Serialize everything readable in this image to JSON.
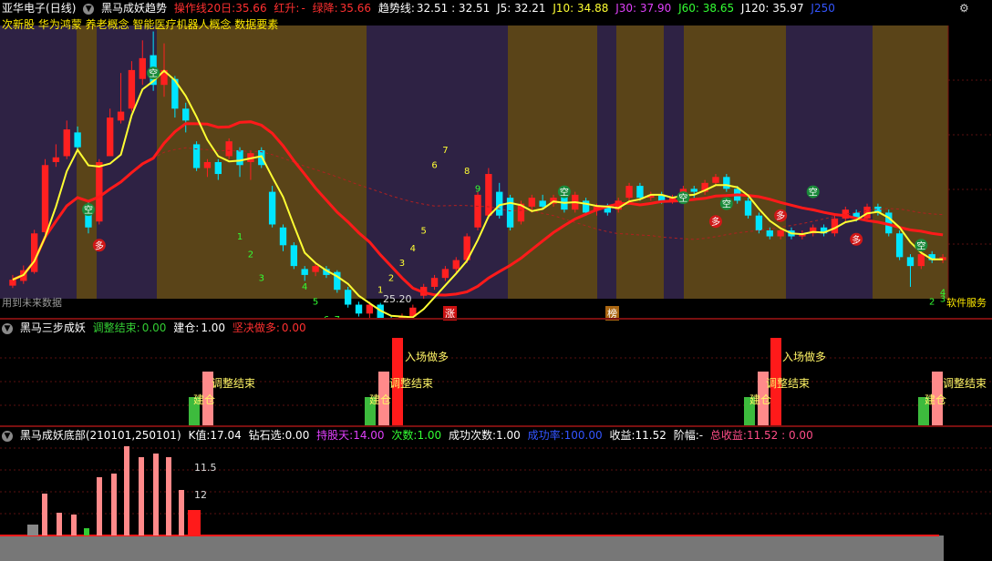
{
  "pane1": {
    "stock_name": "亚华电子",
    "period": "(日线)",
    "indicator": "黑马成妖趋势",
    "ops_label": "操作线20日:",
    "ops_value": "35.66",
    "up_label": "红升:",
    "up_value": "-",
    "down_label": "绿降:",
    "down_value": "35.66",
    "trend_label": "趋势线:",
    "trend_value": "32.51 : 32.51",
    "j5": "J5: 32.21",
    "j10": "J10: 34.88",
    "j30": "J30: 37.90",
    "j60": "J60: 38.65",
    "j120": "J120: 35.97",
    "j250": "J250",
    "concepts": "次新股 华为鸿蒙 养老概念 智能医疗机器人概念 数据要素",
    "future_data": "用到未来数据",
    "low_price": "25.20",
    "zhang": "涨",
    "bang": "榜",
    "software": "软件服务",
    "kong": "空",
    "duo": "多",
    "colors": {
      "red": "#ff2020",
      "cyan": "#00e5ff",
      "yellow": "#ffff33",
      "purple": "#2e2244",
      "olive": "#5a4418"
    }
  },
  "pane2": {
    "title": "黑马三步成妖",
    "adjust_label": "调整结束:",
    "adjust_value": "0.00",
    "build_label": "建仓:",
    "build_value": "1.00",
    "long_label": "坚决做多:",
    "long_value": "0.00",
    "enter_text": "入场做多",
    "adjust_text": "调整结束",
    "build_text": "建仓"
  },
  "pane3": {
    "title": "黑马成妖底部(210101,250101)",
    "k_label": "K值:",
    "k_value": "17.04",
    "diamond_label": "钻石选:",
    "diamond_value": "0.00",
    "hold_label": "持股天:",
    "hold_value": "14.00",
    "times_label": "次数:",
    "times_value": "1.00",
    "success_label": "成功次数:",
    "success_value": "1.00",
    "rate_label": "成功率:",
    "rate_value": "100.00",
    "profit_label": "收益:",
    "profit_value": "11.52",
    "range_label": "阶幅:",
    "range_value": "-",
    "total_label": "总收益:",
    "total_value": "11.52 : 0.00",
    "bar_label_1": "11.5",
    "bar_label_2": "12"
  },
  "chart_data": {
    "type": "candlestick",
    "price_range": [
      24,
      70
    ],
    "candles": [
      {
        "o": 26.2,
        "c": 27.2,
        "h": 28.0,
        "l": 25.8
      },
      {
        "o": 27.0,
        "c": 28.8,
        "h": 29.6,
        "l": 26.5
      },
      {
        "o": 28.5,
        "c": 35.0,
        "h": 35.6,
        "l": 28.2
      },
      {
        "o": 35.2,
        "c": 46.5,
        "h": 47.5,
        "l": 34.8
      },
      {
        "o": 47.0,
        "c": 47.8,
        "h": 50.0,
        "l": 46.2
      },
      {
        "o": 48.0,
        "c": 52.5,
        "h": 54.0,
        "l": 47.5
      },
      {
        "o": 52.0,
        "c": 49.5,
        "h": 53.0,
        "l": 49.0
      },
      {
        "o": 39.5,
        "c": 36.0,
        "h": 40.5,
        "l": 35.0
      },
      {
        "o": 37.0,
        "c": 47.0,
        "h": 47.5,
        "l": 36.5
      },
      {
        "o": 48.0,
        "c": 54.5,
        "h": 56.0,
        "l": 48.0
      },
      {
        "o": 54.0,
        "c": 55.5,
        "h": 62.0,
        "l": 53.5
      },
      {
        "o": 56.0,
        "c": 62.5,
        "h": 64.0,
        "l": 55.5
      },
      {
        "o": 61.0,
        "c": 64.5,
        "h": 67.5,
        "l": 60.0
      },
      {
        "o": 65.0,
        "c": 60.0,
        "h": 69.0,
        "l": 59.0
      },
      {
        "o": 60.0,
        "c": 62.5,
        "h": 67.0,
        "l": 58.0
      },
      {
        "o": 61.0,
        "c": 56.0,
        "h": 61.5,
        "l": 54.5
      },
      {
        "o": 56.0,
        "c": 54.0,
        "h": 57.0,
        "l": 52.0
      },
      {
        "o": 50.0,
        "c": 46.0,
        "h": 50.5,
        "l": 45.5
      },
      {
        "o": 46.0,
        "c": 47.0,
        "h": 47.5,
        "l": 44.5
      },
      {
        "o": 47.0,
        "c": 45.0,
        "h": 47.5,
        "l": 44.0
      },
      {
        "o": 48.0,
        "c": 50.5,
        "h": 51.0,
        "l": 47.5
      },
      {
        "o": 49.0,
        "c": 46.5,
        "h": 49.5,
        "l": 44.5
      },
      {
        "o": 47.0,
        "c": 48.5,
        "h": 49.0,
        "l": 44.0
      },
      {
        "o": 49.0,
        "c": 46.5,
        "h": 49.5,
        "l": 46.0
      },
      {
        "o": 42.0,
        "c": 36.5,
        "h": 43.0,
        "l": 36.0
      },
      {
        "o": 36.0,
        "c": 33.0,
        "h": 36.5,
        "l": 32.0
      },
      {
        "o": 33.0,
        "c": 29.5,
        "h": 33.5,
        "l": 29.0
      },
      {
        "o": 29.0,
        "c": 28.0,
        "h": 29.5,
        "l": 27.0
      },
      {
        "o": 28.5,
        "c": 29.5,
        "h": 30.0,
        "l": 27.8
      },
      {
        "o": 29.0,
        "c": 28.0,
        "h": 29.5,
        "l": 27.5
      },
      {
        "o": 28.5,
        "c": 25.5,
        "h": 28.8,
        "l": 25.0
      },
      {
        "o": 25.5,
        "c": 23.0,
        "h": 26.0,
        "l": 22.5
      },
      {
        "o": 23.0,
        "c": 21.5,
        "h": 23.5,
        "l": 21.0
      },
      {
        "o": 21.5,
        "c": 23.0,
        "h": 23.5,
        "l": 20.5
      },
      {
        "o": 23.0,
        "c": 20.5,
        "h": 23.3,
        "l": 20.0
      },
      {
        "o": 20.5,
        "c": 19.5,
        "h": 21.0,
        "l": 17.5
      },
      {
        "o": 19.0,
        "c": 21.0,
        "h": 21.5,
        "l": 18.5
      },
      {
        "o": 21.0,
        "c": 22.5,
        "h": 23.0,
        "l": 20.5
      },
      {
        "o": 24.5,
        "c": 26.0,
        "h": 26.5,
        "l": 24.0
      },
      {
        "o": 26.0,
        "c": 27.5,
        "h": 28.0,
        "l": 25.5
      },
      {
        "o": 27.5,
        "c": 29.0,
        "h": 29.5,
        "l": 27.0
      },
      {
        "o": 29.0,
        "c": 30.5,
        "h": 31.0,
        "l": 28.5
      },
      {
        "o": 30.5,
        "c": 34.5,
        "h": 35.0,
        "l": 30.0
      },
      {
        "o": 36.0,
        "c": 41.5,
        "h": 42.0,
        "l": 35.5
      },
      {
        "o": 38.0,
        "c": 45.0,
        "h": 46.0,
        "l": 37.5
      },
      {
        "o": 42.0,
        "c": 38.0,
        "h": 43.5,
        "l": 37.5
      },
      {
        "o": 41.0,
        "c": 36.0,
        "h": 41.5,
        "l": 35.5
      },
      {
        "o": 37.0,
        "c": 40.0,
        "h": 40.5,
        "l": 36.5
      },
      {
        "o": 39.5,
        "c": 41.0,
        "h": 41.5,
        "l": 38.5
      },
      {
        "o": 40.5,
        "c": 39.5,
        "h": 41.5,
        "l": 39.0
      },
      {
        "o": 40.0,
        "c": 41.0,
        "h": 41.5,
        "l": 39.5
      },
      {
        "o": 41.5,
        "c": 39.0,
        "h": 42.0,
        "l": 38.5
      },
      {
        "o": 39.0,
        "c": 41.5,
        "h": 42.0,
        "l": 38.5
      },
      {
        "o": 40.5,
        "c": 38.5,
        "h": 41.0,
        "l": 38.0
      },
      {
        "o": 39.0,
        "c": 39.5,
        "h": 40.0,
        "l": 38.0
      },
      {
        "o": 39.5,
        "c": 38.5,
        "h": 40.0,
        "l": 38.0
      },
      {
        "o": 39.0,
        "c": 40.5,
        "h": 41.0,
        "l": 38.5
      },
      {
        "o": 41.0,
        "c": 43.0,
        "h": 43.5,
        "l": 40.5
      },
      {
        "o": 43.0,
        "c": 41.0,
        "h": 43.5,
        "l": 40.5
      },
      {
        "o": 41.0,
        "c": 41.5,
        "h": 42.0,
        "l": 40.5
      },
      {
        "o": 41.5,
        "c": 40.5,
        "h": 42.0,
        "l": 40.0
      },
      {
        "o": 40.5,
        "c": 41.0,
        "h": 41.5,
        "l": 40.0
      },
      {
        "o": 41.0,
        "c": 42.5,
        "h": 43.0,
        "l": 40.5
      },
      {
        "o": 42.5,
        "c": 42.0,
        "h": 43.0,
        "l": 41.0
      },
      {
        "o": 42.0,
        "c": 43.5,
        "h": 44.0,
        "l": 41.5
      },
      {
        "o": 43.5,
        "c": 44.5,
        "h": 45.0,
        "l": 43.0
      },
      {
        "o": 44.5,
        "c": 42.5,
        "h": 45.0,
        "l": 42.0
      },
      {
        "o": 42.5,
        "c": 40.5,
        "h": 43.0,
        "l": 40.0
      },
      {
        "o": 40.5,
        "c": 38.0,
        "h": 41.0,
        "l": 37.5
      },
      {
        "o": 38.0,
        "c": 35.5,
        "h": 38.5,
        "l": 35.0
      },
      {
        "o": 35.5,
        "c": 34.5,
        "h": 36.0,
        "l": 34.0
      },
      {
        "o": 34.5,
        "c": 35.5,
        "h": 36.0,
        "l": 34.0
      },
      {
        "o": 35.5,
        "c": 34.5,
        "h": 36.0,
        "l": 34.0
      },
      {
        "o": 34.5,
        "c": 35.0,
        "h": 35.5,
        "l": 34.0
      },
      {
        "o": 35.0,
        "c": 36.0,
        "h": 36.5,
        "l": 34.5
      },
      {
        "o": 36.0,
        "c": 35.0,
        "h": 36.5,
        "l": 34.5
      },
      {
        "o": 35.0,
        "c": 37.5,
        "h": 38.0,
        "l": 34.5
      },
      {
        "o": 37.5,
        "c": 39.0,
        "h": 39.5,
        "l": 37.0
      },
      {
        "o": 38.5,
        "c": 37.5,
        "h": 39.0,
        "l": 37.0
      },
      {
        "o": 37.5,
        "c": 39.5,
        "h": 40.0,
        "l": 37.0
      },
      {
        "o": 39.5,
        "c": 38.5,
        "h": 40.0,
        "l": 38.0
      },
      {
        "o": 38.5,
        "c": 35.0,
        "h": 39.0,
        "l": 34.5
      },
      {
        "o": 35.0,
        "c": 31.0,
        "h": 35.5,
        "l": 30.5
      },
      {
        "o": 31.0,
        "c": 29.5,
        "h": 31.5,
        "l": 26.0
      },
      {
        "o": 29.5,
        "c": 31.5,
        "h": 32.0,
        "l": 29.0
      },
      {
        "o": 31.5,
        "c": 30.5,
        "h": 32.0,
        "l": 30.0
      },
      {
        "o": 30.5,
        "c": 31.0,
        "h": 31.5,
        "l": 30.0
      }
    ]
  }
}
